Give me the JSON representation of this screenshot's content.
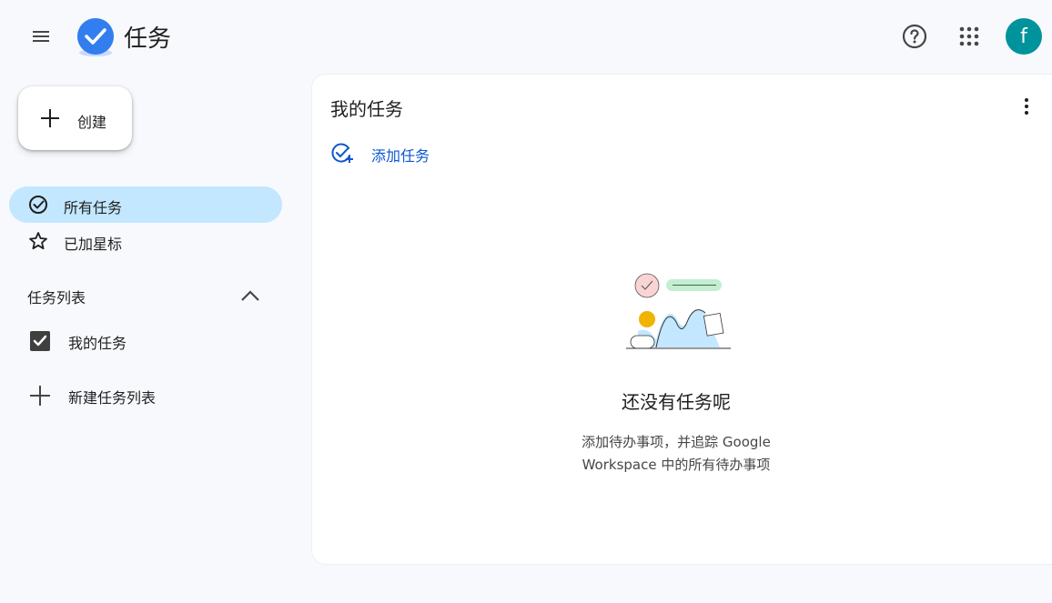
{
  "header": {
    "app_title": "任务",
    "avatar_letter": "f",
    "icons": {
      "menu": "menu-icon",
      "logo": "tasks-logo-icon",
      "help": "help-icon",
      "apps": "apps-grid-icon"
    }
  },
  "sidebar": {
    "create_label": "创建",
    "nav": [
      {
        "label": "所有任务",
        "icon": "check-circle-icon",
        "active": true
      },
      {
        "label": "已加星标",
        "icon": "star-outline-icon",
        "active": false
      }
    ],
    "section_title": "任务列表",
    "lists": [
      {
        "label": "我的任务",
        "checked": true
      }
    ],
    "new_list_label": "新建任务列表"
  },
  "main": {
    "title": "我的任务",
    "add_task_label": "添加任务",
    "empty_title": "还没有任务呢",
    "empty_desc_line1": "添加待办事项，并追踪 Google",
    "empty_desc_line2": "Workspace 中的所有待办事项"
  },
  "colors": {
    "accent_blue": "#0b57d0",
    "active_nav_bg": "#c2e7ff",
    "avatar_bg": "#00939b",
    "page_bg": "#f8f9fd"
  }
}
